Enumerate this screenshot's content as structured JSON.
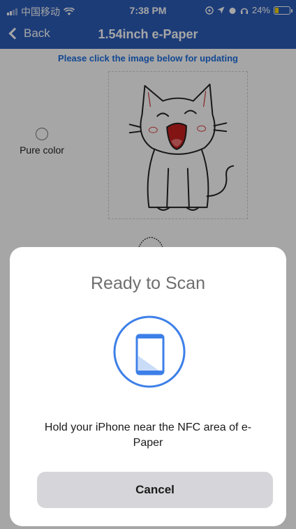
{
  "status_bar": {
    "carrier": "中国移动",
    "time": "7:38 PM",
    "battery_percent": "24%",
    "battery_level": 0.24
  },
  "nav": {
    "back_label": "Back",
    "title": "1.54inch e-Paper"
  },
  "main": {
    "hint": "Please click the image below for updating",
    "radio_label": "Pure color"
  },
  "nfc_sheet": {
    "title": "Ready to Scan",
    "message": "Hold your iPhone near the NFC area of e-Paper",
    "cancel_label": "Cancel"
  },
  "colors": {
    "nav_bg": "#2C5DB8",
    "accent": "#1E6FE0",
    "nfc_blue": "#3D7FE8",
    "battery": "#F5D600"
  }
}
